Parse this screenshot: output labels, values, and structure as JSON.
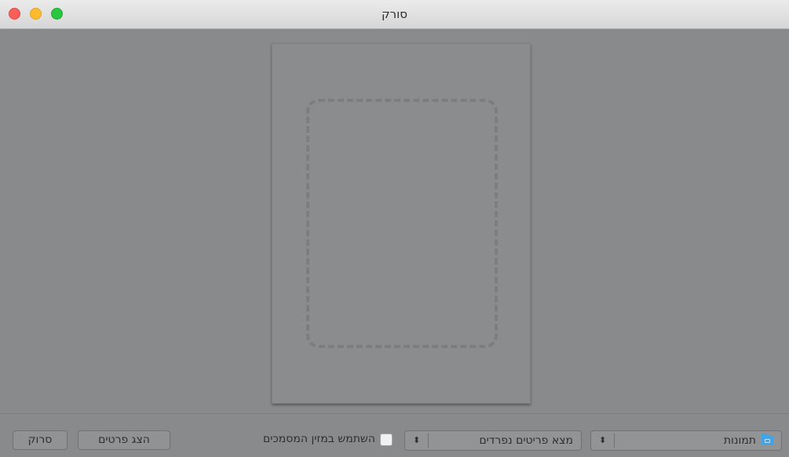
{
  "window": {
    "title": "סורק"
  },
  "toolbar": {
    "scan_label": "סרוק",
    "show_details_label": "הצג פרטים",
    "use_document_feeder_label": "השתמש במזין המסמכים",
    "use_document_feeder_checked": false
  },
  "selects": {
    "find_items": {
      "value": "מצא פריטים נפרדים",
      "arrows": "⬍"
    },
    "destination": {
      "value": "תמונות",
      "icon": "folder-icon",
      "arrows": "⬍"
    }
  },
  "colors": {
    "close": "#fc5f57",
    "minimize": "#fdbc2e",
    "maximize": "#29c840",
    "folder": "#3ea6e8"
  }
}
